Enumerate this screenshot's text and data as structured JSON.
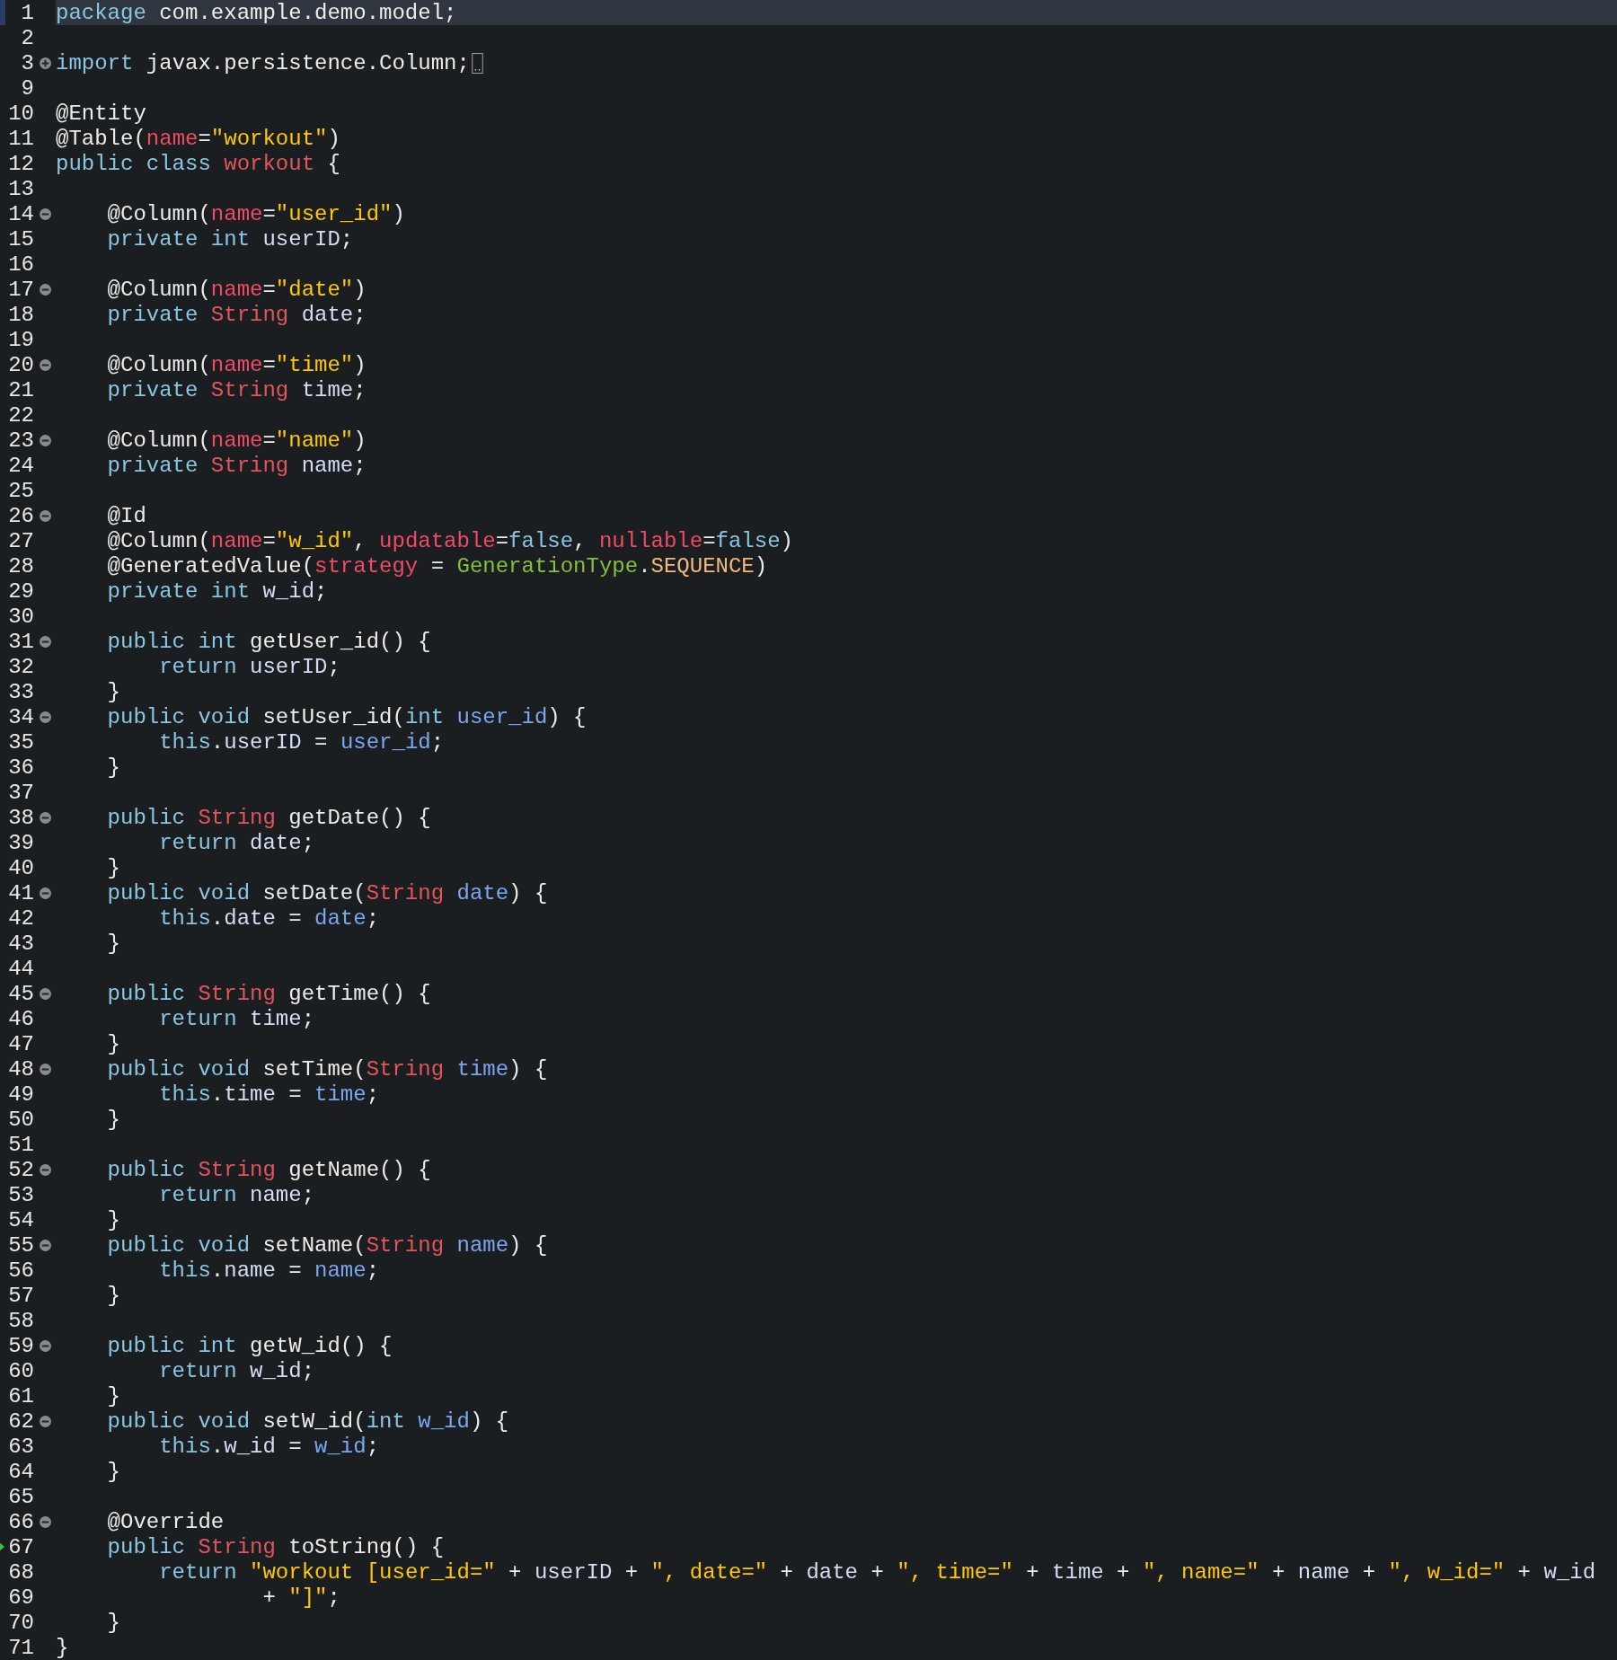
{
  "editor": {
    "lines": [
      {
        "n": "1",
        "foldable": false,
        "collapsed": false,
        "current": true,
        "marked": false,
        "tokens": [
          {
            "kind": "kw",
            "text": "package "
          },
          {
            "kind": "plain",
            "text": "com.example.demo.model;"
          }
        ]
      },
      {
        "n": "2",
        "foldable": false,
        "collapsed": false,
        "current": false,
        "marked": false
      },
      {
        "n": "3",
        "foldable": true,
        "collapsed": true,
        "current": false,
        "marked": false,
        "tokens": [
          {
            "kind": "kw",
            "text": "import "
          },
          {
            "kind": "plain",
            "text": "javax.persistence.Column;"
          }
        ]
      },
      {
        "n": "9",
        "foldable": false,
        "collapsed": false,
        "current": false,
        "marked": false
      },
      {
        "n": "10",
        "foldable": false,
        "collapsed": false,
        "current": false,
        "marked": false,
        "tokens": [
          {
            "kind": "plain",
            "text": "@Entity"
          }
        ]
      },
      {
        "n": "11",
        "foldable": false,
        "collapsed": false,
        "current": false,
        "marked": false,
        "tokens": [
          {
            "kind": "plain",
            "text": "@Table("
          },
          {
            "kind": "attr",
            "text": "name"
          },
          {
            "kind": "plain",
            "text": "="
          },
          {
            "kind": "str",
            "text": "\"workout\""
          },
          {
            "kind": "plain",
            "text": ")"
          }
        ]
      },
      {
        "n": "12",
        "foldable": false,
        "collapsed": false,
        "current": false,
        "marked": false,
        "tokens": [
          {
            "kind": "kw",
            "text": "public class "
          },
          {
            "kind": "type",
            "text": "workout"
          },
          {
            "kind": "plain",
            "text": " {"
          }
        ]
      },
      {
        "n": "13",
        "foldable": false,
        "collapsed": false,
        "current": false,
        "marked": false
      },
      {
        "n": "14",
        "foldable": true,
        "collapsed": false,
        "current": false,
        "marked": false,
        "tokens": [
          {
            "kind": "plain",
            "text": "    @Column("
          },
          {
            "kind": "attr",
            "text": "name"
          },
          {
            "kind": "plain",
            "text": "="
          },
          {
            "kind": "str",
            "text": "\"user_id\""
          },
          {
            "kind": "plain",
            "text": ")"
          }
        ]
      },
      {
        "n": "15",
        "foldable": false,
        "collapsed": false,
        "current": false,
        "marked": false,
        "tokens": [
          {
            "kind": "kw",
            "text": "    private int "
          },
          {
            "kind": "field",
            "text": "userID"
          },
          {
            "kind": "plain",
            "text": ";"
          }
        ]
      },
      {
        "n": "16",
        "foldable": false,
        "collapsed": false,
        "current": false,
        "marked": false
      },
      {
        "n": "17",
        "foldable": true,
        "collapsed": false,
        "current": false,
        "marked": false,
        "tokens": [
          {
            "kind": "plain",
            "text": "    @Column("
          },
          {
            "kind": "attr",
            "text": "name"
          },
          {
            "kind": "plain",
            "text": "="
          },
          {
            "kind": "str",
            "text": "\"date\""
          },
          {
            "kind": "plain",
            "text": ")"
          }
        ]
      },
      {
        "n": "18",
        "foldable": false,
        "collapsed": false,
        "current": false,
        "marked": false,
        "tokens": [
          {
            "kind": "kw",
            "text": "    private "
          },
          {
            "kind": "type",
            "text": "String "
          },
          {
            "kind": "field",
            "text": "date"
          },
          {
            "kind": "plain",
            "text": ";"
          }
        ]
      },
      {
        "n": "19",
        "foldable": false,
        "collapsed": false,
        "current": false,
        "marked": false
      },
      {
        "n": "20",
        "foldable": true,
        "collapsed": false,
        "current": false,
        "marked": false,
        "tokens": [
          {
            "kind": "plain",
            "text": "    @Column("
          },
          {
            "kind": "attr",
            "text": "name"
          },
          {
            "kind": "plain",
            "text": "="
          },
          {
            "kind": "str",
            "text": "\"time\""
          },
          {
            "kind": "plain",
            "text": ")"
          }
        ]
      },
      {
        "n": "21",
        "foldable": false,
        "collapsed": false,
        "current": false,
        "marked": false,
        "tokens": [
          {
            "kind": "kw",
            "text": "    private "
          },
          {
            "kind": "type",
            "text": "String "
          },
          {
            "kind": "field",
            "text": "time"
          },
          {
            "kind": "plain",
            "text": ";"
          }
        ]
      },
      {
        "n": "22",
        "foldable": false,
        "collapsed": false,
        "current": false,
        "marked": false
      },
      {
        "n": "23",
        "foldable": true,
        "collapsed": false,
        "current": false,
        "marked": false,
        "tokens": [
          {
            "kind": "plain",
            "text": "    @Column("
          },
          {
            "kind": "attr",
            "text": "name"
          },
          {
            "kind": "plain",
            "text": "="
          },
          {
            "kind": "str",
            "text": "\"name\""
          },
          {
            "kind": "plain",
            "text": ")"
          }
        ]
      },
      {
        "n": "24",
        "foldable": false,
        "collapsed": false,
        "current": false,
        "marked": false,
        "tokens": [
          {
            "kind": "kw",
            "text": "    private "
          },
          {
            "kind": "type",
            "text": "String "
          },
          {
            "kind": "field",
            "text": "name"
          },
          {
            "kind": "plain",
            "text": ";"
          }
        ]
      },
      {
        "n": "25",
        "foldable": false,
        "collapsed": false,
        "current": false,
        "marked": false
      },
      {
        "n": "26",
        "foldable": true,
        "collapsed": false,
        "current": false,
        "marked": false,
        "tokens": [
          {
            "kind": "plain",
            "text": "    @Id"
          }
        ]
      },
      {
        "n": "27",
        "foldable": false,
        "collapsed": false,
        "current": false,
        "marked": false,
        "tokens": [
          {
            "kind": "plain",
            "text": "    @Column("
          },
          {
            "kind": "attr",
            "text": "name"
          },
          {
            "kind": "plain",
            "text": "="
          },
          {
            "kind": "str",
            "text": "\"w_id\""
          },
          {
            "kind": "plain",
            "text": ", "
          },
          {
            "kind": "attr",
            "text": "updatable"
          },
          {
            "kind": "plain",
            "text": "="
          },
          {
            "kind": "kw",
            "text": "false"
          },
          {
            "kind": "plain",
            "text": ", "
          },
          {
            "kind": "attr",
            "text": "nullable"
          },
          {
            "kind": "plain",
            "text": "="
          },
          {
            "kind": "kw",
            "text": "false"
          },
          {
            "kind": "plain",
            "text": ")"
          }
        ]
      },
      {
        "n": "28",
        "foldable": false,
        "collapsed": false,
        "current": false,
        "marked": false,
        "tokens": [
          {
            "kind": "plain",
            "text": "    @GeneratedValue("
          },
          {
            "kind": "attr",
            "text": "strategy"
          },
          {
            "kind": "plain",
            "text": " = "
          },
          {
            "kind": "enumtype",
            "text": "GenerationType"
          },
          {
            "kind": "plain",
            "text": "."
          },
          {
            "kind": "enumconst",
            "text": "SEQUENCE"
          },
          {
            "kind": "plain",
            "text": ")"
          }
        ]
      },
      {
        "n": "29",
        "foldable": false,
        "collapsed": false,
        "current": false,
        "marked": false,
        "tokens": [
          {
            "kind": "kw",
            "text": "    private int "
          },
          {
            "kind": "field",
            "text": "w_id"
          },
          {
            "kind": "plain",
            "text": ";"
          }
        ]
      },
      {
        "n": "30",
        "foldable": false,
        "collapsed": false,
        "current": false,
        "marked": false
      },
      {
        "n": "31",
        "foldable": true,
        "collapsed": false,
        "current": false,
        "marked": false,
        "tokens": [
          {
            "kind": "kw",
            "text": "    public int "
          },
          {
            "kind": "plain",
            "text": "getUser_id() {"
          }
        ]
      },
      {
        "n": "32",
        "foldable": false,
        "collapsed": false,
        "current": false,
        "marked": false,
        "tokens": [
          {
            "kind": "kw",
            "text": "        return "
          },
          {
            "kind": "field",
            "text": "userID"
          },
          {
            "kind": "plain",
            "text": ";"
          }
        ]
      },
      {
        "n": "33",
        "foldable": false,
        "collapsed": false,
        "current": false,
        "marked": false,
        "tokens": [
          {
            "kind": "plain",
            "text": "    }"
          }
        ]
      },
      {
        "n": "34",
        "foldable": true,
        "collapsed": false,
        "current": false,
        "marked": false,
        "tokens": [
          {
            "kind": "kw",
            "text": "    public void "
          },
          {
            "kind": "plain",
            "text": "setUser_id("
          },
          {
            "kind": "kw",
            "text": "int "
          },
          {
            "kind": "param",
            "text": "user_id"
          },
          {
            "kind": "plain",
            "text": ") {"
          }
        ]
      },
      {
        "n": "35",
        "foldable": false,
        "collapsed": false,
        "current": false,
        "marked": false,
        "tokens": [
          {
            "kind": "kw",
            "text": "        this"
          },
          {
            "kind": "plain",
            "text": "."
          },
          {
            "kind": "field",
            "text": "userID"
          },
          {
            "kind": "plain",
            "text": " = "
          },
          {
            "kind": "param",
            "text": "user_id"
          },
          {
            "kind": "plain",
            "text": ";"
          }
        ]
      },
      {
        "n": "36",
        "foldable": false,
        "collapsed": false,
        "current": false,
        "marked": false,
        "tokens": [
          {
            "kind": "plain",
            "text": "    }"
          }
        ]
      },
      {
        "n": "37",
        "foldable": false,
        "collapsed": false,
        "current": false,
        "marked": false
      },
      {
        "n": "38",
        "foldable": true,
        "collapsed": false,
        "current": false,
        "marked": false,
        "tokens": [
          {
            "kind": "kw",
            "text": "    public "
          },
          {
            "kind": "type",
            "text": "String "
          },
          {
            "kind": "plain",
            "text": "getDate() {"
          }
        ]
      },
      {
        "n": "39",
        "foldable": false,
        "collapsed": false,
        "current": false,
        "marked": false,
        "tokens": [
          {
            "kind": "kw",
            "text": "        return "
          },
          {
            "kind": "field",
            "text": "date"
          },
          {
            "kind": "plain",
            "text": ";"
          }
        ]
      },
      {
        "n": "40",
        "foldable": false,
        "collapsed": false,
        "current": false,
        "marked": false,
        "tokens": [
          {
            "kind": "plain",
            "text": "    }"
          }
        ]
      },
      {
        "n": "41",
        "foldable": true,
        "collapsed": false,
        "current": false,
        "marked": false,
        "tokens": [
          {
            "kind": "kw",
            "text": "    public void "
          },
          {
            "kind": "plain",
            "text": "setDate("
          },
          {
            "kind": "type",
            "text": "String "
          },
          {
            "kind": "param",
            "text": "date"
          },
          {
            "kind": "plain",
            "text": ") {"
          }
        ]
      },
      {
        "n": "42",
        "foldable": false,
        "collapsed": false,
        "current": false,
        "marked": false,
        "tokens": [
          {
            "kind": "kw",
            "text": "        this"
          },
          {
            "kind": "plain",
            "text": "."
          },
          {
            "kind": "field",
            "text": "date"
          },
          {
            "kind": "plain",
            "text": " = "
          },
          {
            "kind": "param",
            "text": "date"
          },
          {
            "kind": "plain",
            "text": ";"
          }
        ]
      },
      {
        "n": "43",
        "foldable": false,
        "collapsed": false,
        "current": false,
        "marked": false,
        "tokens": [
          {
            "kind": "plain",
            "text": "    }"
          }
        ]
      },
      {
        "n": "44",
        "foldable": false,
        "collapsed": false,
        "current": false,
        "marked": false
      },
      {
        "n": "45",
        "foldable": true,
        "collapsed": false,
        "current": false,
        "marked": false,
        "tokens": [
          {
            "kind": "kw",
            "text": "    public "
          },
          {
            "kind": "type",
            "text": "String "
          },
          {
            "kind": "plain",
            "text": "getTime() {"
          }
        ]
      },
      {
        "n": "46",
        "foldable": false,
        "collapsed": false,
        "current": false,
        "marked": false,
        "tokens": [
          {
            "kind": "kw",
            "text": "        return "
          },
          {
            "kind": "field",
            "text": "time"
          },
          {
            "kind": "plain",
            "text": ";"
          }
        ]
      },
      {
        "n": "47",
        "foldable": false,
        "collapsed": false,
        "current": false,
        "marked": false,
        "tokens": [
          {
            "kind": "plain",
            "text": "    }"
          }
        ]
      },
      {
        "n": "48",
        "foldable": true,
        "collapsed": false,
        "current": false,
        "marked": false,
        "tokens": [
          {
            "kind": "kw",
            "text": "    public void "
          },
          {
            "kind": "plain",
            "text": "setTime("
          },
          {
            "kind": "type",
            "text": "String "
          },
          {
            "kind": "param",
            "text": "time"
          },
          {
            "kind": "plain",
            "text": ") {"
          }
        ]
      },
      {
        "n": "49",
        "foldable": false,
        "collapsed": false,
        "current": false,
        "marked": false,
        "tokens": [
          {
            "kind": "kw",
            "text": "        this"
          },
          {
            "kind": "plain",
            "text": "."
          },
          {
            "kind": "field",
            "text": "time"
          },
          {
            "kind": "plain",
            "text": " = "
          },
          {
            "kind": "param",
            "text": "time"
          },
          {
            "kind": "plain",
            "text": ";"
          }
        ]
      },
      {
        "n": "50",
        "foldable": false,
        "collapsed": false,
        "current": false,
        "marked": false,
        "tokens": [
          {
            "kind": "plain",
            "text": "    }"
          }
        ]
      },
      {
        "n": "51",
        "foldable": false,
        "collapsed": false,
        "current": false,
        "marked": false
      },
      {
        "n": "52",
        "foldable": true,
        "collapsed": false,
        "current": false,
        "marked": false,
        "tokens": [
          {
            "kind": "kw",
            "text": "    public "
          },
          {
            "kind": "type",
            "text": "String "
          },
          {
            "kind": "plain",
            "text": "getName() {"
          }
        ]
      },
      {
        "n": "53",
        "foldable": false,
        "collapsed": false,
        "current": false,
        "marked": false,
        "tokens": [
          {
            "kind": "kw",
            "text": "        return "
          },
          {
            "kind": "field",
            "text": "name"
          },
          {
            "kind": "plain",
            "text": ";"
          }
        ]
      },
      {
        "n": "54",
        "foldable": false,
        "collapsed": false,
        "current": false,
        "marked": false,
        "tokens": [
          {
            "kind": "plain",
            "text": "    }"
          }
        ]
      },
      {
        "n": "55",
        "foldable": true,
        "collapsed": false,
        "current": false,
        "marked": false,
        "tokens": [
          {
            "kind": "kw",
            "text": "    public void "
          },
          {
            "kind": "plain",
            "text": "setName("
          },
          {
            "kind": "type",
            "text": "String "
          },
          {
            "kind": "param",
            "text": "name"
          },
          {
            "kind": "plain",
            "text": ") {"
          }
        ]
      },
      {
        "n": "56",
        "foldable": false,
        "collapsed": false,
        "current": false,
        "marked": false,
        "tokens": [
          {
            "kind": "kw",
            "text": "        this"
          },
          {
            "kind": "plain",
            "text": "."
          },
          {
            "kind": "field",
            "text": "name"
          },
          {
            "kind": "plain",
            "text": " = "
          },
          {
            "kind": "param",
            "text": "name"
          },
          {
            "kind": "plain",
            "text": ";"
          }
        ]
      },
      {
        "n": "57",
        "foldable": false,
        "collapsed": false,
        "current": false,
        "marked": false,
        "tokens": [
          {
            "kind": "plain",
            "text": "    }"
          }
        ]
      },
      {
        "n": "58",
        "foldable": false,
        "collapsed": false,
        "current": false,
        "marked": false
      },
      {
        "n": "59",
        "foldable": true,
        "collapsed": false,
        "current": false,
        "marked": false,
        "tokens": [
          {
            "kind": "kw",
            "text": "    public int "
          },
          {
            "kind": "plain",
            "text": "getW_id() {"
          }
        ]
      },
      {
        "n": "60",
        "foldable": false,
        "collapsed": false,
        "current": false,
        "marked": false,
        "tokens": [
          {
            "kind": "kw",
            "text": "        return "
          },
          {
            "kind": "field",
            "text": "w_id"
          },
          {
            "kind": "plain",
            "text": ";"
          }
        ]
      },
      {
        "n": "61",
        "foldable": false,
        "collapsed": false,
        "current": false,
        "marked": false,
        "tokens": [
          {
            "kind": "plain",
            "text": "    }"
          }
        ]
      },
      {
        "n": "62",
        "foldable": true,
        "collapsed": false,
        "current": false,
        "marked": false,
        "tokens": [
          {
            "kind": "kw",
            "text": "    public void "
          },
          {
            "kind": "plain",
            "text": "setW_id("
          },
          {
            "kind": "kw",
            "text": "int "
          },
          {
            "kind": "param",
            "text": "w_id"
          },
          {
            "kind": "plain",
            "text": ") {"
          }
        ]
      },
      {
        "n": "63",
        "foldable": false,
        "collapsed": false,
        "current": false,
        "marked": false,
        "tokens": [
          {
            "kind": "kw",
            "text": "        this"
          },
          {
            "kind": "plain",
            "text": "."
          },
          {
            "kind": "field",
            "text": "w_id"
          },
          {
            "kind": "plain",
            "text": " = "
          },
          {
            "kind": "param",
            "text": "w_id"
          },
          {
            "kind": "plain",
            "text": ";"
          }
        ]
      },
      {
        "n": "64",
        "foldable": false,
        "collapsed": false,
        "current": false,
        "marked": false,
        "tokens": [
          {
            "kind": "plain",
            "text": "    }"
          }
        ]
      },
      {
        "n": "65",
        "foldable": false,
        "collapsed": false,
        "current": false,
        "marked": false
      },
      {
        "n": "66",
        "foldable": true,
        "collapsed": false,
        "current": false,
        "marked": false,
        "tokens": [
          {
            "kind": "plain",
            "text": "    @Override"
          }
        ]
      },
      {
        "n": "67",
        "foldable": false,
        "collapsed": false,
        "current": false,
        "marked": true,
        "tokens": [
          {
            "kind": "kw",
            "text": "    public "
          },
          {
            "kind": "type",
            "text": "String "
          },
          {
            "kind": "plain",
            "text": "toString() {"
          }
        ]
      },
      {
        "n": "68",
        "foldable": false,
        "collapsed": false,
        "current": false,
        "marked": false,
        "tokens": [
          {
            "kind": "kw",
            "text": "        return "
          },
          {
            "kind": "str",
            "text": "\"workout [user_id=\""
          },
          {
            "kind": "plain",
            "text": " + "
          },
          {
            "kind": "field",
            "text": "userID"
          },
          {
            "kind": "plain",
            "text": " + "
          },
          {
            "kind": "str",
            "text": "\", date=\""
          },
          {
            "kind": "plain",
            "text": " + "
          },
          {
            "kind": "field",
            "text": "date"
          },
          {
            "kind": "plain",
            "text": " + "
          },
          {
            "kind": "str",
            "text": "\", time=\""
          },
          {
            "kind": "plain",
            "text": " + "
          },
          {
            "kind": "field",
            "text": "time"
          },
          {
            "kind": "plain",
            "text": " + "
          },
          {
            "kind": "str",
            "text": "\", name=\""
          },
          {
            "kind": "plain",
            "text": " + "
          },
          {
            "kind": "field",
            "text": "name"
          },
          {
            "kind": "plain",
            "text": " + "
          },
          {
            "kind": "str",
            "text": "\", w_id=\""
          },
          {
            "kind": "plain",
            "text": " + "
          },
          {
            "kind": "field",
            "text": "w_id"
          }
        ]
      },
      {
        "n": "69",
        "foldable": false,
        "collapsed": false,
        "current": false,
        "marked": false,
        "tokens": [
          {
            "kind": "plain",
            "text": "                + "
          },
          {
            "kind": "str",
            "text": "\"]\""
          },
          {
            "kind": "plain",
            "text": ";"
          }
        ]
      },
      {
        "n": "70",
        "foldable": false,
        "collapsed": false,
        "current": false,
        "marked": false,
        "tokens": [
          {
            "kind": "plain",
            "text": "    }"
          }
        ]
      },
      {
        "n": "71",
        "foldable": false,
        "collapsed": false,
        "current": false,
        "marked": false,
        "tokens": [
          {
            "kind": "plain",
            "text": "}"
          }
        ]
      }
    ]
  }
}
